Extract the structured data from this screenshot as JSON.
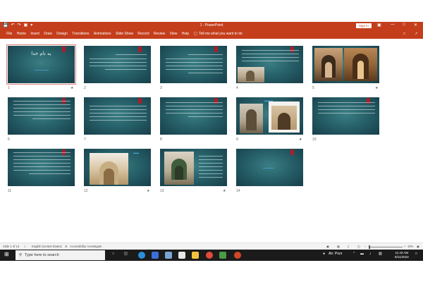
{
  "app": {
    "doc_title": "1 - PowerPoint",
    "sign_in": "Sign in"
  },
  "ribbon": {
    "tabs": [
      "File",
      "Home",
      "Insert",
      "Draw",
      "Design",
      "Transitions",
      "Animations",
      "Slide Show",
      "Record",
      "Review",
      "View",
      "Help"
    ],
    "tell_me": "Tell me what you want to do"
  },
  "slides": [
    {
      "number": "1",
      "selected": true,
      "title": "به نام خدا",
      "starred": true
    },
    {
      "number": "2"
    },
    {
      "number": "3"
    },
    {
      "number": "4"
    },
    {
      "number": "5",
      "starred": true
    },
    {
      "number": "6"
    },
    {
      "number": "7"
    },
    {
      "number": "8"
    },
    {
      "number": "9",
      "starred": true
    },
    {
      "number": "10"
    },
    {
      "number": "11"
    },
    {
      "number": "12",
      "starred": true
    },
    {
      "number": "13",
      "starred": true
    },
    {
      "number": "14"
    }
  ],
  "status": {
    "slide_count": "Slide 1 of 14",
    "language": "English (United States)",
    "accessibility": "Accessibility: Investigate",
    "zoom": "15%",
    "zoom_level": 0.15
  },
  "taskbar": {
    "search_placeholder": "Type here to search",
    "weather": "Air: Poor",
    "time": "11:43 AM",
    "date": "8/11/2023"
  },
  "colors": {
    "accent": "#c43e1c",
    "slide_bg": "#27616a",
    "slide_header": "#a81f2b"
  }
}
